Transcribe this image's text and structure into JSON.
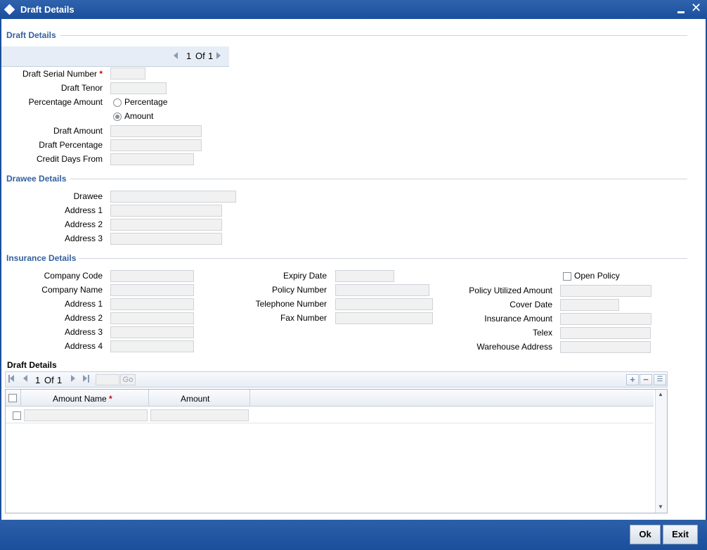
{
  "window": {
    "title": "Draft Details"
  },
  "draft_section": {
    "title": "Draft Details",
    "pager": {
      "current": "1",
      "of_label": "Of",
      "total": "1"
    },
    "serial_label": "Draft Serial Number",
    "tenor_label": "Draft Tenor",
    "percentage_amount_label": "Percentage Amount",
    "radio_percentage": "Percentage",
    "radio_amount": "Amount",
    "draft_amount_label": "Draft Amount",
    "draft_percentage_label": "Draft Percentage",
    "credit_days_label": "Credit Days From"
  },
  "drawee_section": {
    "title": "Drawee Details",
    "drawee_label": "Drawee",
    "address1_label": "Address 1",
    "address2_label": "Address 2",
    "address3_label": "Address 3"
  },
  "insurance_section": {
    "title": "Insurance Details",
    "company_code_label": "Company Code",
    "company_name_label": "Company Name",
    "address1_label": "Address 1",
    "address2_label": "Address 2",
    "address3_label": "Address 3",
    "address4_label": "Address 4",
    "expiry_date_label": "Expiry Date",
    "policy_number_label": "Policy Number",
    "telephone_label": "Telephone Number",
    "fax_label": "Fax Number",
    "open_policy_label": "Open Policy",
    "policy_utilized_label": "Policy Utilized Amount",
    "cover_date_label": "Cover Date",
    "insurance_amount_label": "Insurance Amount",
    "telex_label": "Telex",
    "warehouse_label": "Warehouse Address"
  },
  "grid_section": {
    "title": "Draft Details",
    "pager": {
      "current": "1",
      "of_label": "Of",
      "total": "1"
    },
    "go_label": "Go",
    "columns": [
      "Amount Name",
      "Amount"
    ]
  },
  "footer": {
    "ok_label": "Ok",
    "exit_label": "Exit"
  }
}
